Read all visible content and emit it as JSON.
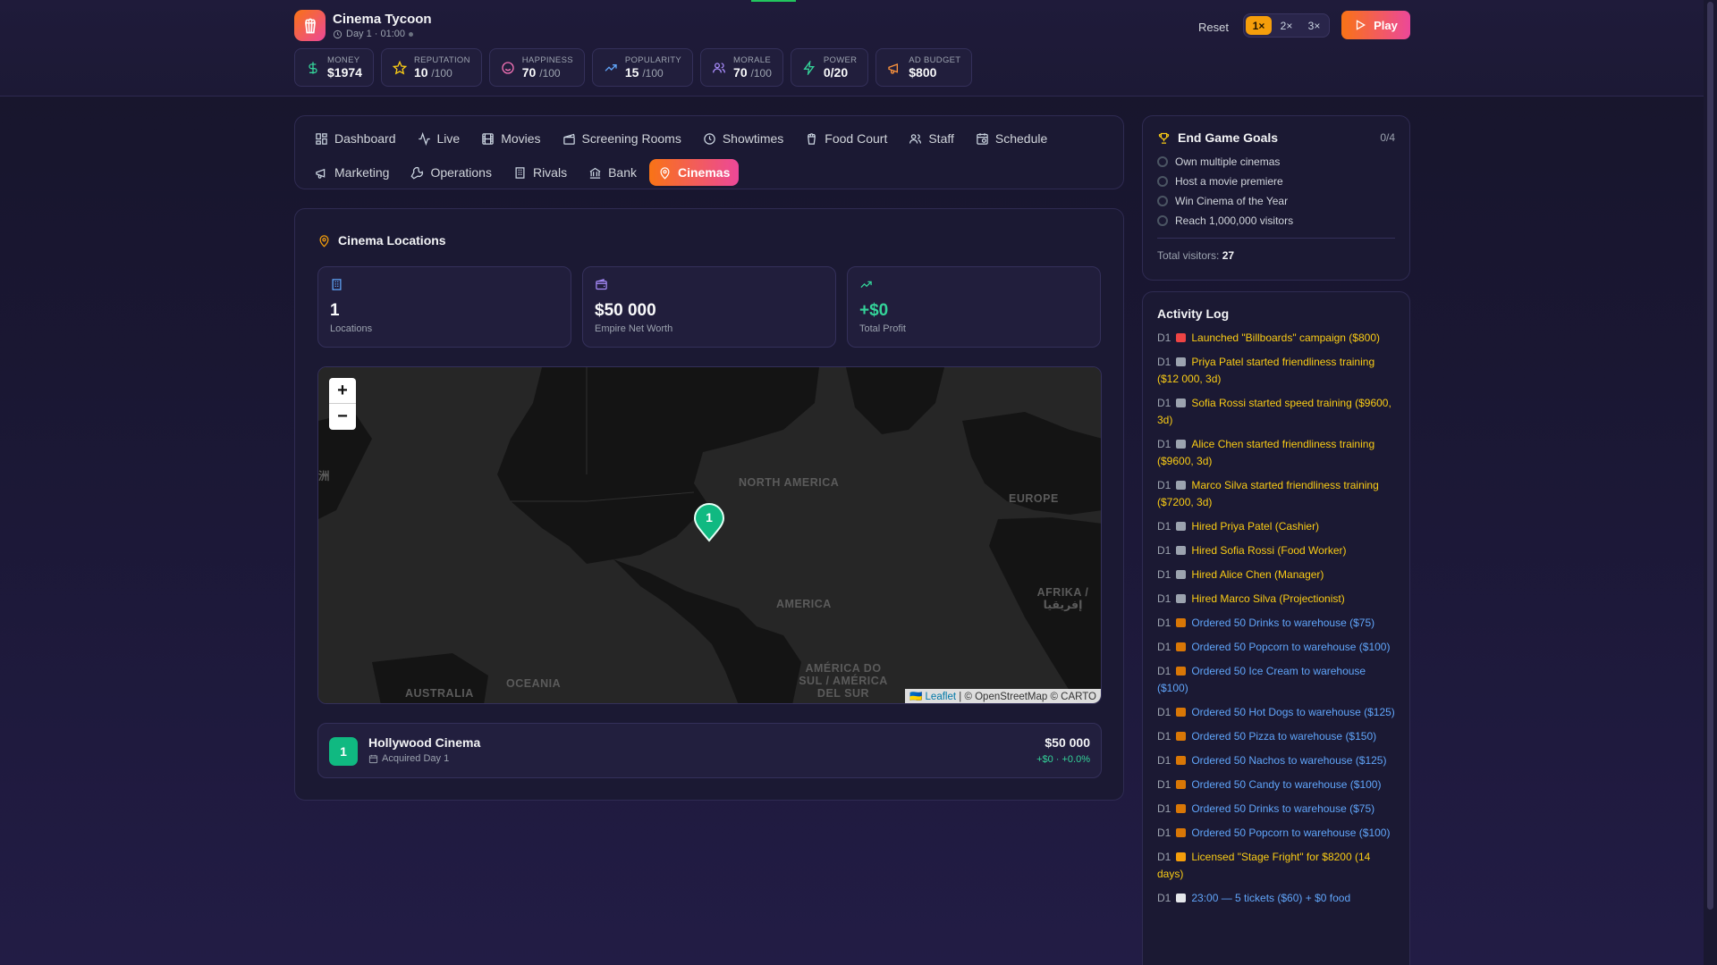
{
  "app": {
    "title": "Cinema Tycoon",
    "day_time": "Day 1 · 01:00"
  },
  "stats": [
    {
      "label": "MONEY",
      "value": "$1974",
      "sub": "",
      "icon": "dollar-icon",
      "color": "#34d399"
    },
    {
      "label": "REPUTATION",
      "value": "10",
      "sub": "/100",
      "icon": "star-icon",
      "color": "#facc15"
    },
    {
      "label": "HAPPINESS",
      "value": "70",
      "sub": "/100",
      "icon": "smile-icon",
      "color": "#f472b6"
    },
    {
      "label": "POPULARITY",
      "value": "15",
      "sub": "/100",
      "icon": "trend-icon",
      "color": "#60a5fa"
    },
    {
      "label": "MORALE",
      "value": "70",
      "sub": "/100",
      "icon": "users-icon",
      "color": "#a78bfa"
    },
    {
      "label": "POWER",
      "value": "0/20",
      "sub": "",
      "icon": "bolt-icon",
      "color": "#34d399"
    },
    {
      "label": "AD BUDGET",
      "value": "$800",
      "sub": "",
      "icon": "megaphone-icon",
      "color": "#fb923c"
    }
  ],
  "controls": {
    "reset": "Reset",
    "speeds": [
      "1×",
      "2×",
      "3×"
    ],
    "active_speed": "1×",
    "play": "Play"
  },
  "nav": {
    "row1": [
      "Dashboard",
      "Live",
      "Movies",
      "Screening Rooms",
      "Showtimes",
      "Food Court",
      "Staff",
      "Schedule"
    ],
    "row2": [
      "Marketing",
      "Operations",
      "Rivals",
      "Bank",
      "Cinemas"
    ],
    "active": "Cinemas"
  },
  "main": {
    "title": "Cinema Locations",
    "kpis": [
      {
        "value": "1",
        "label": "Locations",
        "icon": "building-icon",
        "color": "#60a5fa"
      },
      {
        "value": "$50 000",
        "label": "Empire Net Worth",
        "icon": "wallet-icon",
        "color": "#a78bfa"
      },
      {
        "value": "+$0",
        "label": "Total Profit",
        "icon": "trend-up-icon",
        "color": "#34d399"
      }
    ],
    "map": {
      "zoom_in": "+",
      "zoom_out": "−",
      "marker": "1",
      "labels": [
        "NORTH AMERICA",
        "EUROPE",
        "AMERICA",
        "AFRIKA / إفريقيا",
        "AMÉRICA DO SUL / AMÉRICA DEL SUR",
        "AUSTRALIA",
        "OCEANIA",
        "洲"
      ],
      "attribution_link": "Leaflet",
      "attribution_text": "| © OpenStreetMap © CARTO"
    },
    "cinema": {
      "number": "1",
      "name": "Hollywood Cinema",
      "acquired": "Acquired Day 1",
      "value": "$50 000",
      "change": "+$0 · +0.0%"
    }
  },
  "goals": {
    "title": "End Game Goals",
    "progress": "0/4",
    "items": [
      "Own multiple cinemas",
      "Host a movie premiere",
      "Win Cinema of the Year",
      "Reach 1,000,000 visitors"
    ],
    "visitors_label": "Total visitors:",
    "visitors_value": "27"
  },
  "log": {
    "title": "Activity Log",
    "items": [
      {
        "day": "D1",
        "text": "Launched \"Billboards\" campaign ($800)",
        "tone": "yellow",
        "icon": "megaphone-icon"
      },
      {
        "day": "D1",
        "text": "Priya Patel started friendliness training ($12 000, 3d)",
        "tone": "yellow",
        "icon": "graduation-icon"
      },
      {
        "day": "D1",
        "text": "Sofia Rossi started speed training ($9600, 3d)",
        "tone": "yellow",
        "icon": "graduation-icon"
      },
      {
        "day": "D1",
        "text": "Alice Chen started friendliness training ($9600, 3d)",
        "tone": "yellow",
        "icon": "graduation-icon"
      },
      {
        "day": "D1",
        "text": "Marco Silva started friendliness training ($7200, 3d)",
        "tone": "yellow",
        "icon": "graduation-icon"
      },
      {
        "day": "D1",
        "text": "Hired Priya Patel (Cashier)",
        "tone": "yellow",
        "icon": "person-icon"
      },
      {
        "day": "D1",
        "text": "Hired Sofia Rossi (Food Worker)",
        "tone": "yellow",
        "icon": "person-icon"
      },
      {
        "day": "D1",
        "text": "Hired Alice Chen (Manager)",
        "tone": "yellow",
        "icon": "person-icon"
      },
      {
        "day": "D1",
        "text": "Hired Marco Silva (Projectionist)",
        "tone": "yellow",
        "icon": "person-icon"
      },
      {
        "day": "D1",
        "text": "Ordered 50 Drinks to warehouse ($75)",
        "tone": "blue",
        "icon": "box-icon"
      },
      {
        "day": "D1",
        "text": "Ordered 50 Popcorn to warehouse ($100)",
        "tone": "blue",
        "icon": "box-icon"
      },
      {
        "day": "D1",
        "text": "Ordered 50 Ice Cream to warehouse ($100)",
        "tone": "blue",
        "icon": "box-icon"
      },
      {
        "day": "D1",
        "text": "Ordered 50 Hot Dogs to warehouse ($125)",
        "tone": "blue",
        "icon": "box-icon"
      },
      {
        "day": "D1",
        "text": "Ordered 50 Pizza to warehouse ($150)",
        "tone": "blue",
        "icon": "box-icon"
      },
      {
        "day": "D1",
        "text": "Ordered 50 Nachos to warehouse ($125)",
        "tone": "blue",
        "icon": "box-icon"
      },
      {
        "day": "D1",
        "text": "Ordered 50 Candy to warehouse ($100)",
        "tone": "blue",
        "icon": "box-icon"
      },
      {
        "day": "D1",
        "text": "Ordered 50 Drinks to warehouse ($75)",
        "tone": "blue",
        "icon": "box-icon"
      },
      {
        "day": "D1",
        "text": "Ordered 50 Popcorn to warehouse ($100)",
        "tone": "blue",
        "icon": "box-icon"
      },
      {
        "day": "D1",
        "text": "Licensed \"Stage Fright\" for $8200 (14 days)",
        "tone": "yellow",
        "icon": "ticket-icon"
      },
      {
        "day": "D1",
        "text": "23:00 — 5 tickets ($60) + $0 food",
        "tone": "blue",
        "icon": "clock-icon"
      }
    ]
  }
}
